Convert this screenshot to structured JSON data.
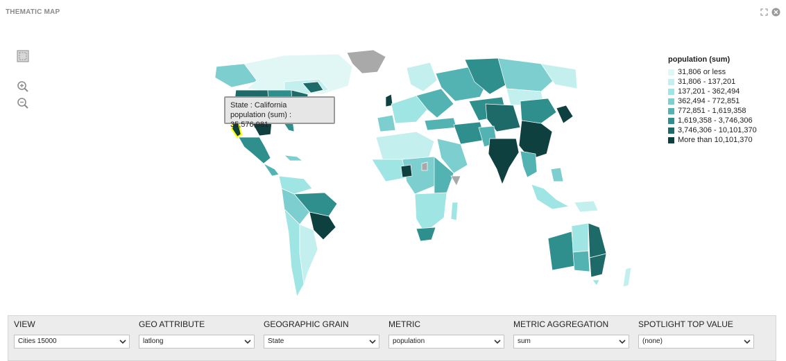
{
  "panel": {
    "title": "THEMATIC MAP"
  },
  "legend": {
    "title": "population (sum)",
    "items": [
      {
        "label": "31,806 or less",
        "color": "#e1f7f5"
      },
      {
        "label": "31,806 - 137,201",
        "color": "#c3f0ee"
      },
      {
        "label": "137,201 - 362,494",
        "color": "#9ee5e3"
      },
      {
        "label": "362,494 - 772,851",
        "color": "#7ccfce"
      },
      {
        "label": "772,851 - 1,619,358",
        "color": "#52b3b2"
      },
      {
        "label": "1,619,358 - 3,746,306",
        "color": "#2e8f8d"
      },
      {
        "label": "3,746,306 - 10,101,370",
        "color": "#1d6a69"
      },
      {
        "label": "More than 10,101,370",
        "color": "#0e403f"
      }
    ]
  },
  "tooltip": {
    "line1": "State : California",
    "line2": "population (sum) : 35,576,981"
  },
  "controls": [
    {
      "label": "VIEW",
      "value": "Cities 15000"
    },
    {
      "label": "GEO ATTRIBUTE",
      "value": "latlong"
    },
    {
      "label": "GEOGRAPHIC GRAIN",
      "value": "State"
    },
    {
      "label": "METRIC",
      "value": "population"
    },
    {
      "label": "METRIC AGGREGATION",
      "value": "sum"
    },
    {
      "label": "SPOTLIGHT TOP VALUE",
      "value": "(none)"
    }
  ],
  "colors": {
    "highlight": "#ffff00",
    "nodata": "#a9a9a9",
    "border": "#ffffff"
  },
  "icons": [
    "expand-icon",
    "close-icon",
    "selection-box-icon",
    "zoom-in-icon",
    "zoom-out-icon",
    "chevron-down-icon"
  ]
}
